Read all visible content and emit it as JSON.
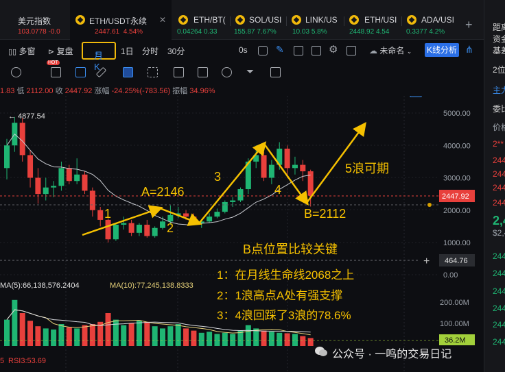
{
  "tabs": [
    {
      "symbol": "美元指数",
      "price": "103.0778",
      "change": "-0.0",
      "change_color": "#e8403c"
    },
    {
      "symbol": "ETH/USDT永续",
      "price": "2447.61",
      "change": "4.54%",
      "change_color": "#e8403c",
      "active": true
    },
    {
      "symbol": "ETH/BT(",
      "price": "0.04264",
      "change": "0.33",
      "change_color": "#1fb573"
    },
    {
      "symbol": "SOL/USI",
      "price": "155.87",
      "change": "7.67%",
      "change_color": "#1fb573"
    },
    {
      "symbol": "LINK/US",
      "price": "10.03",
      "change": "5.8%",
      "change_color": "#1fb573"
    },
    {
      "symbol": "ETH/USI",
      "price": "2448.92",
      "change": "4.54",
      "change_color": "#1fb573"
    },
    {
      "symbol": "ADA/USI",
      "price": "0.3377",
      "change": "4.2%",
      "change_color": "#1fb573"
    }
  ],
  "toolbar": {
    "multi_window": "多窗",
    "replay": "复盘",
    "period_selected": "月K",
    "period_1d": "1日",
    "period_time": "分时",
    "period_30": "30分",
    "seconds": "0s",
    "unnamed": "未命名",
    "k_analysis": "K线分析",
    "hot": "HOT"
  },
  "info_line": {
    "high_tail": "1.83",
    "low_label": "低",
    "low": "2112.00",
    "close_label": "收",
    "close": "2447.92",
    "change_label": "涨幅",
    "change": "-24.25%(-783.56)",
    "amplitude_label": "振幅",
    "amplitude": "34.96%"
  },
  "indicators": {
    "ma5": "MA(5):66,138,576.2404",
    "ma10": "MA(10):77,245,138.8333",
    "rsi_prefix": "5",
    "rsi": "RSI3:53.69"
  },
  "price_axis": {
    "ticks": [
      "5000.00",
      "4000.00",
      "3000.00",
      "2000.00",
      "1000.00",
      "0.00"
    ],
    "current_price": "2447.92",
    "cursor_price": "464.76",
    "volume_ticks": [
      "200.00M",
      "100.00M"
    ],
    "current_volume": "36.2M",
    "peak_label": "4877.54"
  },
  "annotations": {
    "a_label": "A=2146",
    "b_label": "B=2112",
    "w1": "1",
    "w2": "2",
    "w3": "3",
    "w4": "4",
    "w5": "5浪可期",
    "headline": "B点位置比较关键",
    "point1": "1：在月线生命线2068之上",
    "point2": "2：1浪高点A处有强支撑",
    "point3": "3：4浪回踩了3浪的78.6%"
  },
  "right_panel": {
    "items": [
      "距离",
      "资金",
      "基差",
      "2位",
      "主力",
      "委比",
      "价格",
      "2**",
      "244",
      "244",
      "244",
      "244",
      "2,4",
      "$2,4",
      "244",
      "244",
      "244",
      "244",
      "244",
      "244"
    ]
  },
  "watermark": "公众号 · 一鸣的交易日记",
  "colors": {
    "up": "#1fb573",
    "down": "#e8403c",
    "accent": "#f0b90b",
    "annotation": "#f5c000",
    "link_blue": "#3b8ef0"
  },
  "chart_data": {
    "type": "candlestick",
    "unit": "USDT",
    "candles": [
      {
        "o": 3300,
        "h": 4200,
        "l": 2950,
        "c": 4000
      },
      {
        "o": 4000,
        "h": 4877.54,
        "l": 3800,
        "c": 4700
      },
      {
        "o": 4700,
        "h": 4850,
        "l": 3500,
        "c": 3700
      },
      {
        "o": 3700,
        "h": 3850,
        "l": 2700,
        "c": 3000
      },
      {
        "o": 3000,
        "h": 3300,
        "l": 2200,
        "c": 2500
      },
      {
        "o": 2500,
        "h": 3000,
        "l": 2300,
        "c": 2700
      },
      {
        "o": 2700,
        "h": 2900,
        "l": 2400,
        "c": 2750
      },
      {
        "o": 2750,
        "h": 3500,
        "l": 2600,
        "c": 3300
      },
      {
        "o": 3300,
        "h": 3400,
        "l": 2800,
        "c": 2900
      },
      {
        "o": 2900,
        "h": 3600,
        "l": 2800,
        "c": 3100
      },
      {
        "o": 3100,
        "h": 3200,
        "l": 2500,
        "c": 2600
      },
      {
        "o": 2600,
        "h": 2700,
        "l": 1800,
        "c": 2000
      },
      {
        "o": 2000,
        "h": 2100,
        "l": 1500,
        "c": 1700
      },
      {
        "o": 1700,
        "h": 1750,
        "l": 1000,
        "c": 1100
      },
      {
        "o": 1100,
        "h": 1600,
        "l": 1050,
        "c": 1550
      },
      {
        "o": 1550,
        "h": 1800,
        "l": 1400,
        "c": 1600
      },
      {
        "o": 1600,
        "h": 1700,
        "l": 1200,
        "c": 1300
      },
      {
        "o": 1300,
        "h": 1600,
        "l": 1200,
        "c": 1550
      },
      {
        "o": 1550,
        "h": 1700,
        "l": 1150,
        "c": 1200
      },
      {
        "o": 1200,
        "h": 1500,
        "l": 1150,
        "c": 1450
      },
      {
        "o": 1450,
        "h": 1800,
        "l": 1400,
        "c": 1650
      },
      {
        "o": 1650,
        "h": 2146,
        "l": 1550,
        "c": 1850
      },
      {
        "o": 1850,
        "h": 2100,
        "l": 1750,
        "c": 1900
      },
      {
        "o": 1900,
        "h": 2000,
        "l": 1700,
        "c": 1800
      },
      {
        "o": 1800,
        "h": 1900,
        "l": 1550,
        "c": 1600
      },
      {
        "o": 1600,
        "h": 1700,
        "l": 1450,
        "c": 1650
      },
      {
        "o": 1650,
        "h": 1900,
        "l": 1600,
        "c": 1800
      },
      {
        "o": 1800,
        "h": 2050,
        "l": 1750,
        "c": 1950
      },
      {
        "o": 1950,
        "h": 2300,
        "l": 1900,
        "c": 2250
      },
      {
        "o": 2250,
        "h": 2400,
        "l": 2100,
        "c": 2300
      },
      {
        "o": 2300,
        "h": 2700,
        "l": 2250,
        "c": 2650
      },
      {
        "o": 2650,
        "h": 3600,
        "l": 2500,
        "c": 3500
      },
      {
        "o": 3500,
        "h": 4000,
        "l": 3300,
        "c": 3700
      },
      {
        "o": 3700,
        "h": 3800,
        "l": 2900,
        "c": 3000
      },
      {
        "o": 3000,
        "h": 3550,
        "l": 2800,
        "c": 3400
      },
      {
        "o": 3400,
        "h": 4100,
        "l": 3250,
        "c": 3900
      },
      {
        "o": 3900,
        "h": 4000,
        "l": 3000,
        "c": 3300
      },
      {
        "o": 3300,
        "h": 3650,
        "l": 3100,
        "c": 3400
      },
      {
        "o": 3400,
        "h": 3550,
        "l": 2900,
        "c": 3200
      },
      {
        "o": 3200,
        "h": 3250,
        "l": 2112,
        "c": 2447.92
      }
    ],
    "volumes_m": [
      120,
      210,
      150,
      115,
      90,
      80,
      75,
      100,
      85,
      80,
      95,
      100,
      110,
      150,
      120,
      95,
      105,
      115,
      110,
      90,
      80,
      90,
      100,
      80,
      70,
      60,
      65,
      55,
      60,
      55,
      70,
      95,
      80,
      70,
      65,
      60,
      58,
      55,
      45,
      36.2
    ],
    "price_range": [
      0,
      5600
    ],
    "volume_range": [
      0,
      250
    ]
  }
}
